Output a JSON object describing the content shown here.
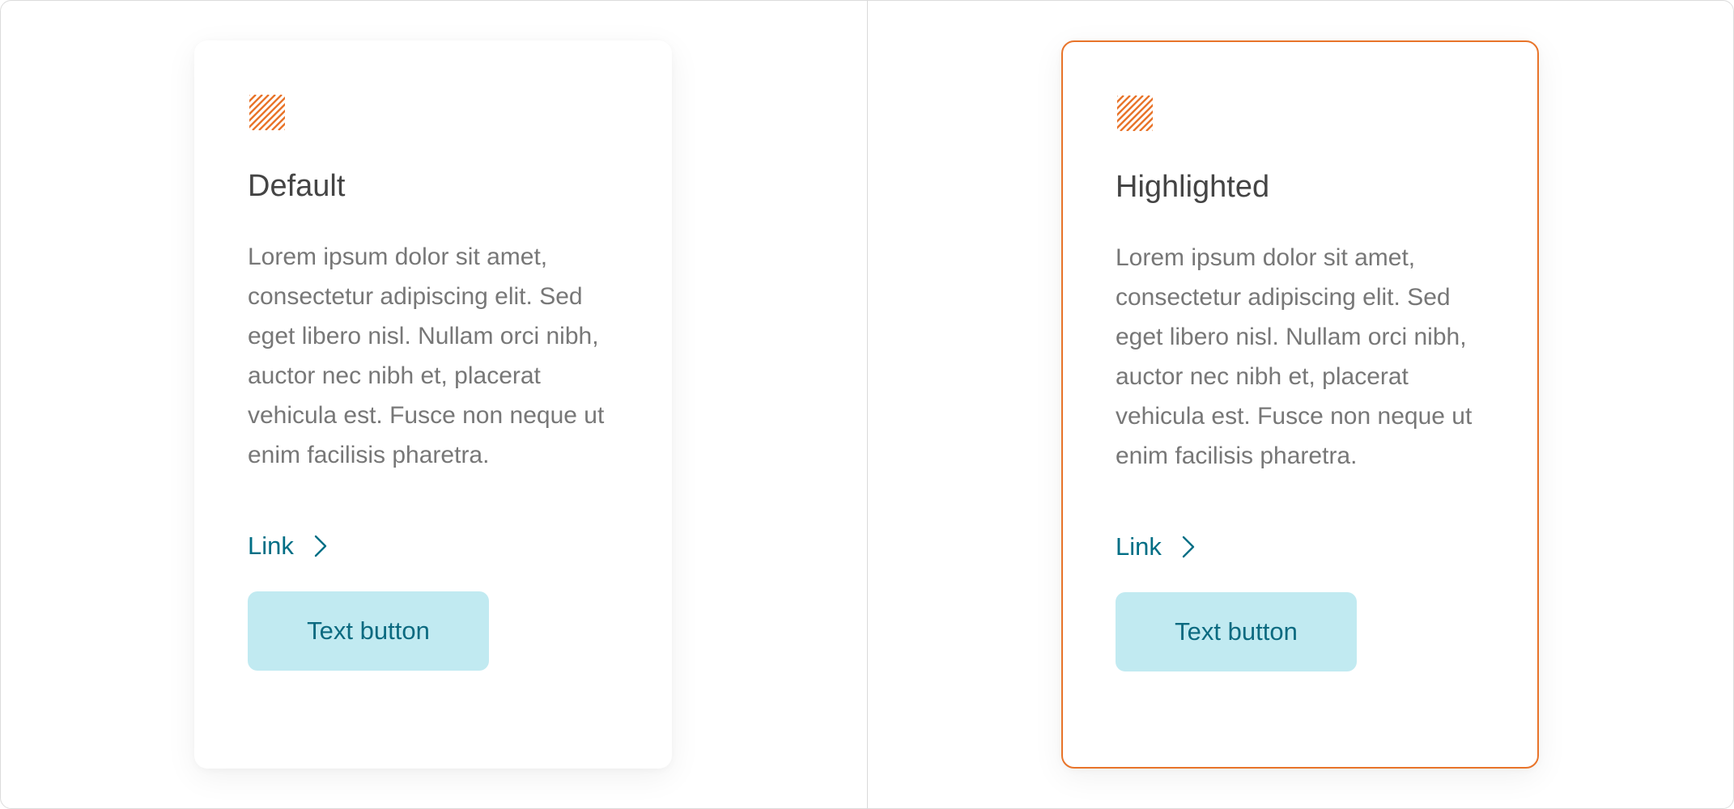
{
  "colors": {
    "accent": "#e8742a",
    "link": "#006e85",
    "button_bg": "#c1eaf1",
    "button_text": "#0b6a80",
    "title": "#444444",
    "body": "#777777"
  },
  "cards": [
    {
      "variant": "default",
      "icon": "hatched-square-icon",
      "title": "Default",
      "body": "Lorem ipsum dolor sit amet, consectetur adipiscing elit. Sed eget libero nisl. Nullam orci nibh, auctor nec nibh et, placerat vehicula est. Fusce non neque ut enim facilisis pharetra.",
      "link_label": "Link",
      "button_label": "Text button"
    },
    {
      "variant": "highlighted",
      "icon": "hatched-square-icon",
      "title": "Highlighted",
      "body": "Lorem ipsum dolor sit amet, consectetur adipiscing elit. Sed eget libero nisl. Nullam orci nibh, auctor nec nibh et, placerat vehicula est. Fusce non neque ut enim facilisis pharetra.",
      "link_label": "Link",
      "button_label": "Text button"
    }
  ]
}
